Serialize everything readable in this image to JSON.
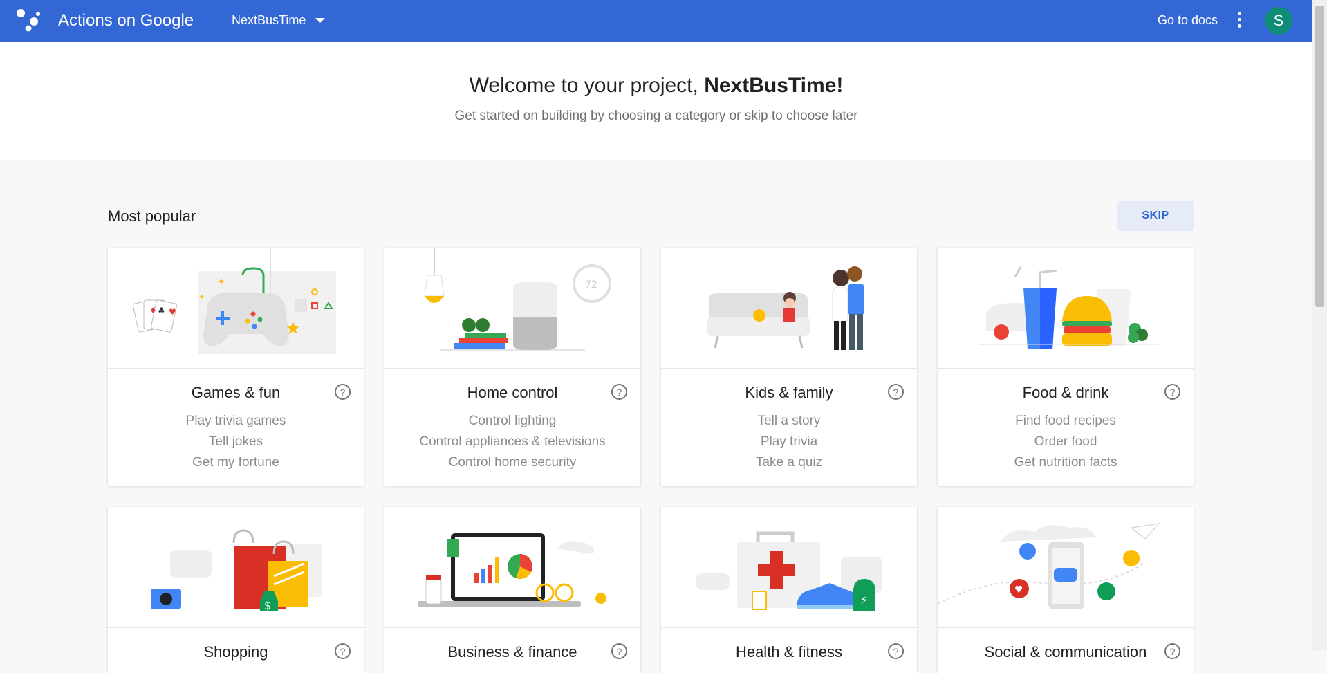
{
  "header": {
    "app_title": "Actions on Google",
    "project_name": "NextBusTime",
    "docs_label": "Go to docs",
    "avatar_initial": "S",
    "bar_color": "#3367d6"
  },
  "hero": {
    "welcome_prefix": "Welcome to your project,",
    "project_name": "NextBusTime!",
    "subtitle": "Get started on building by choosing a category or skip to choose later"
  },
  "section": {
    "title": "Most popular",
    "skip_label": "SKIP"
  },
  "cards": [
    {
      "name": "Games & fun",
      "examples": [
        "Play trivia games",
        "Tell jokes",
        "Get my fortune"
      ],
      "icon": "game-controller-illustration"
    },
    {
      "name": "Home control",
      "examples": [
        "Control lighting",
        "Control appliances & televisions",
        "Control home security"
      ],
      "icon": "smart-home-illustration"
    },
    {
      "name": "Kids & family",
      "examples": [
        "Tell a story",
        "Play trivia",
        "Take a quiz"
      ],
      "icon": "family-illustration"
    },
    {
      "name": "Food & drink",
      "examples": [
        "Find food recipes",
        "Order food",
        "Get nutrition facts"
      ],
      "icon": "burger-drink-illustration"
    },
    {
      "name": "Shopping",
      "icon": "shopping-bags-illustration"
    },
    {
      "name": "Business & finance",
      "icon": "laptop-chart-illustration"
    },
    {
      "name": "Health & fitness",
      "icon": "first-aid-illustration"
    },
    {
      "name": "Social & communication",
      "icon": "phone-chat-illustration"
    }
  ]
}
